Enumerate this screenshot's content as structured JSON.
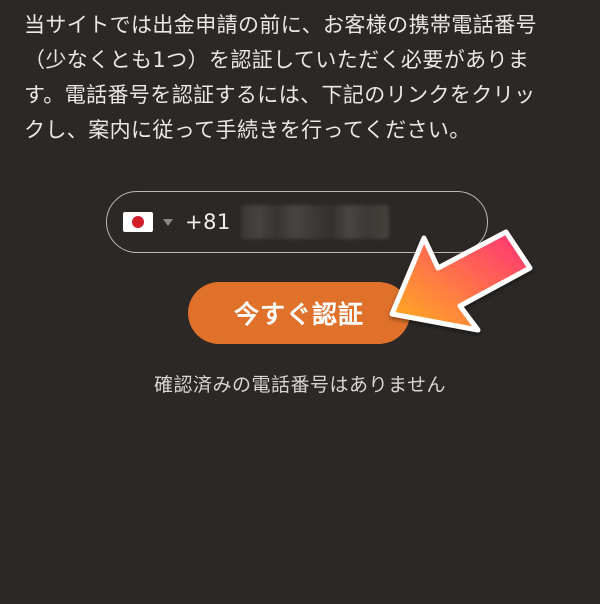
{
  "intro": {
    "lines": [
      "当サイトでは出金申請の前に、お客様の携帯電話番号",
      "（少なくとも1つ）を認証していただく必要がありま",
      "す。電話番号を認証するには、下記のリンクをクリッ",
      "クし、案内に従って手続きを行ってください。"
    ]
  },
  "phone": {
    "country_flag": "japan-flag-icon",
    "dial_code": "+81"
  },
  "verify_button": {
    "label": "今すぐ認証"
  },
  "status": {
    "text": "確認済みの電話番号はありません"
  },
  "colors": {
    "background": "#2b2826",
    "accent": "#e0712a",
    "arrow_start": "#ffb21c",
    "arrow_end": "#ff2f7a"
  }
}
